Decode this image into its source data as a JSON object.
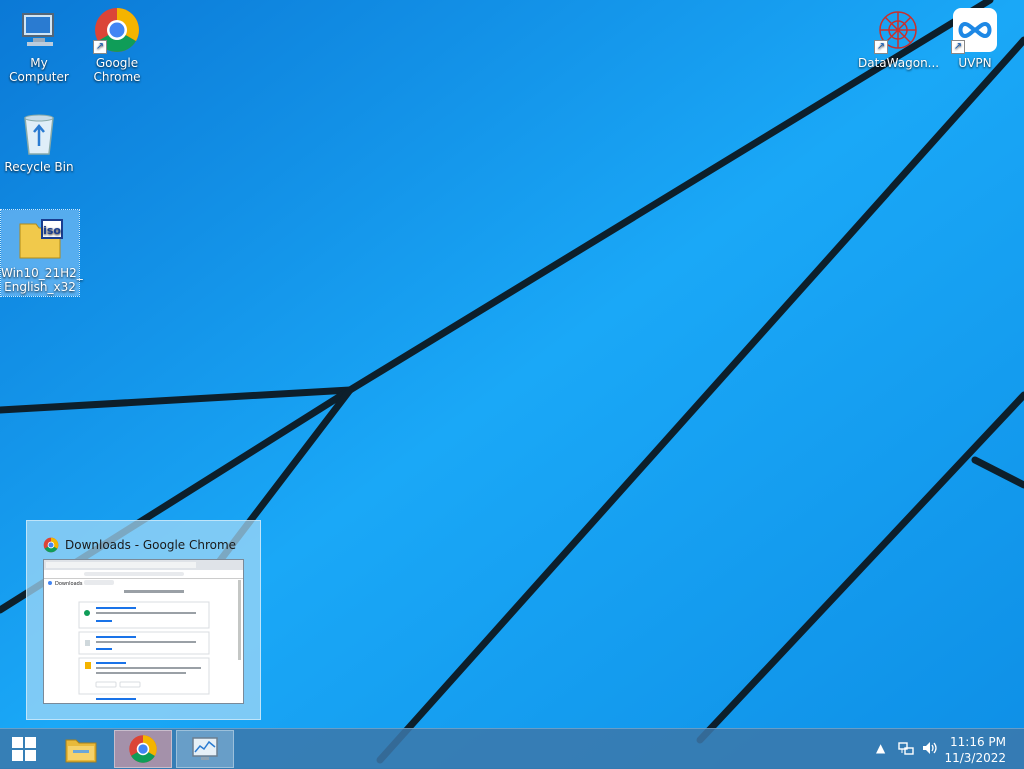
{
  "desktop": {
    "icons": [
      {
        "label_line1": "My Computer",
        "label_line2": ""
      },
      {
        "label_line1": "Google",
        "label_line2": "Chrome"
      },
      {
        "label_line1": "Recycle Bin",
        "label_line2": ""
      },
      {
        "label_line1": "Win10_21H2_",
        "label_line2": "English_x32"
      },
      {
        "label_line1": "DataWagon...",
        "label_line2": ""
      },
      {
        "label_line1": "UVPN",
        "label_line2": ""
      }
    ]
  },
  "preview": {
    "title": "Downloads - Google Chrome",
    "thumb_page_title": "Downloads"
  },
  "taskbar": {
    "time": "11:16 PM",
    "date": "11/3/2022"
  },
  "colors": {
    "wallpaper_light": "#1fb0ff",
    "wallpaper_dark": "#0470c8",
    "taskbar": "#3c78aa",
    "chrome_red": "#db4437",
    "chrome_yellow": "#f4b400",
    "chrome_green": "#0f9d58",
    "chrome_blue": "#4285f4"
  }
}
